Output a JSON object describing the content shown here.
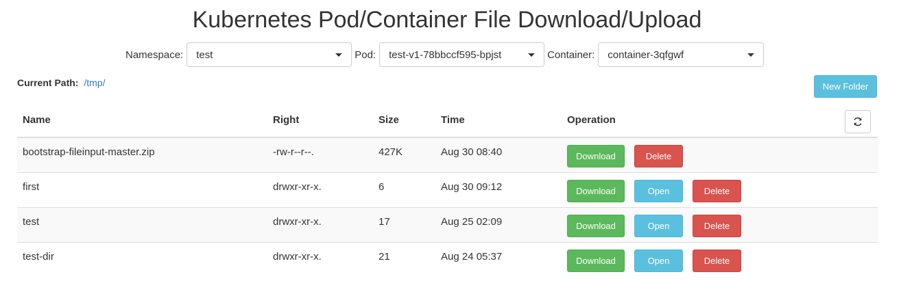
{
  "title": "Kubernetes Pod/Container File Download/Upload",
  "filters": {
    "namespace_label": "Namespace:",
    "namespace_value": "test",
    "pod_label": "Pod:",
    "pod_value": "test-v1-78bbccf595-bpjst",
    "container_label": "Container:",
    "container_value": "container-3qfgwf"
  },
  "path": {
    "label": "Current Path:",
    "value": "/tmp/"
  },
  "new_folder_label": "New Folder",
  "refresh_icon": "refresh-icon",
  "columns": [
    "Name",
    "Right",
    "Size",
    "Time",
    "Operation"
  ],
  "rows": [
    {
      "name": "bootstrap-fileinput-master.zip",
      "right": "-rw-r--r--.",
      "size": "427K",
      "time": "Aug 30 08:40",
      "download": "Download",
      "delete": "Delete"
    },
    {
      "name": "first",
      "right": "drwxr-xr-x.",
      "size": "6",
      "time": "Aug 30 09:12",
      "download": "Download",
      "open": "Open",
      "delete": "Delete"
    },
    {
      "name": "test",
      "right": "drwxr-xr-x.",
      "size": "17",
      "time": "Aug 25 02:09",
      "download": "Download",
      "open": "Open",
      "delete": "Delete"
    },
    {
      "name": "test-dir",
      "right": "drwxr-xr-x.",
      "size": "21",
      "time": "Aug 24 05:37",
      "download": "Download",
      "open": "Open",
      "delete": "Delete"
    }
  ],
  "colors": {
    "success": "#5cb85c",
    "info": "#5bc0de",
    "danger": "#d9534f",
    "link": "#337ab7"
  }
}
